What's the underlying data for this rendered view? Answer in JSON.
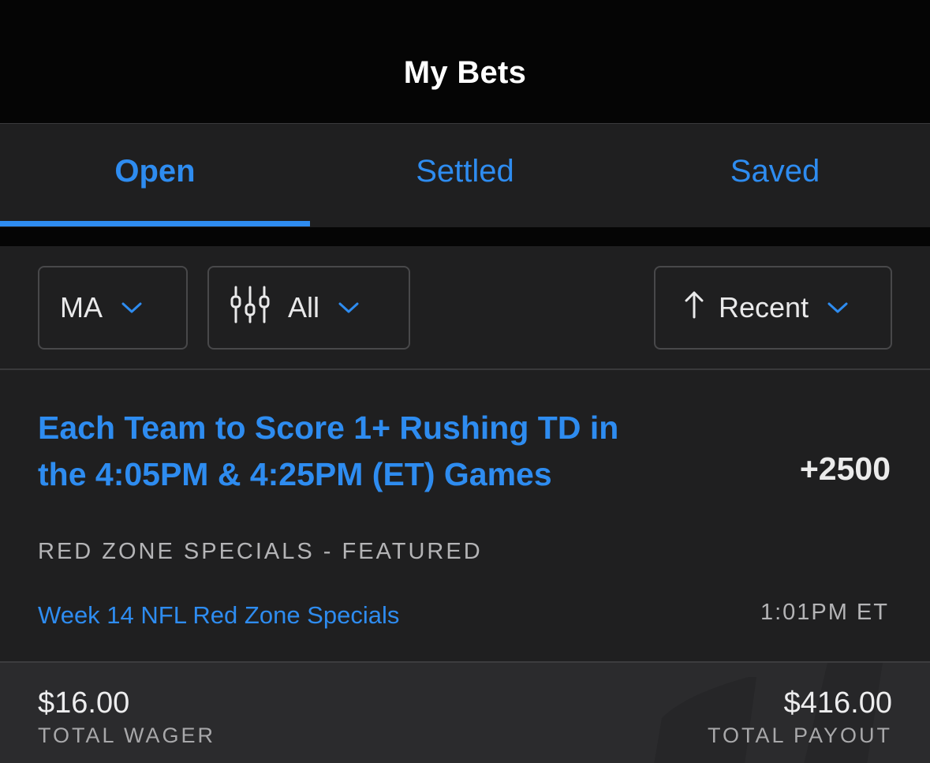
{
  "header": {
    "title": "My Bets"
  },
  "tabs": [
    {
      "label": "Open",
      "active": true
    },
    {
      "label": "Settled",
      "active": false
    },
    {
      "label": "Saved",
      "active": false
    }
  ],
  "filters": {
    "state": {
      "value": "MA",
      "icon": "chevron-down-icon"
    },
    "type": {
      "value": "All",
      "icon": "sliders-icon"
    },
    "sort": {
      "value": "Recent",
      "icon": "arrow-up-icon"
    }
  },
  "bet": {
    "title": "Each Team to Score 1+ Rushing TD in the 4:05PM & 4:25PM (ET) Games",
    "odds": "+2500",
    "category": "RED ZONE SPECIALS - FEATURED",
    "event": "Week 14 NFL Red Zone Specials",
    "time": "1:01PM ET"
  },
  "summary": {
    "wager_amount": "$16.00",
    "wager_label": "TOTAL WAGER",
    "payout_amount": "$416.00",
    "payout_label": "TOTAL PAYOUT"
  },
  "colors": {
    "accent": "#2e8cf0",
    "background": "#1f1f20",
    "header": "#050505"
  }
}
